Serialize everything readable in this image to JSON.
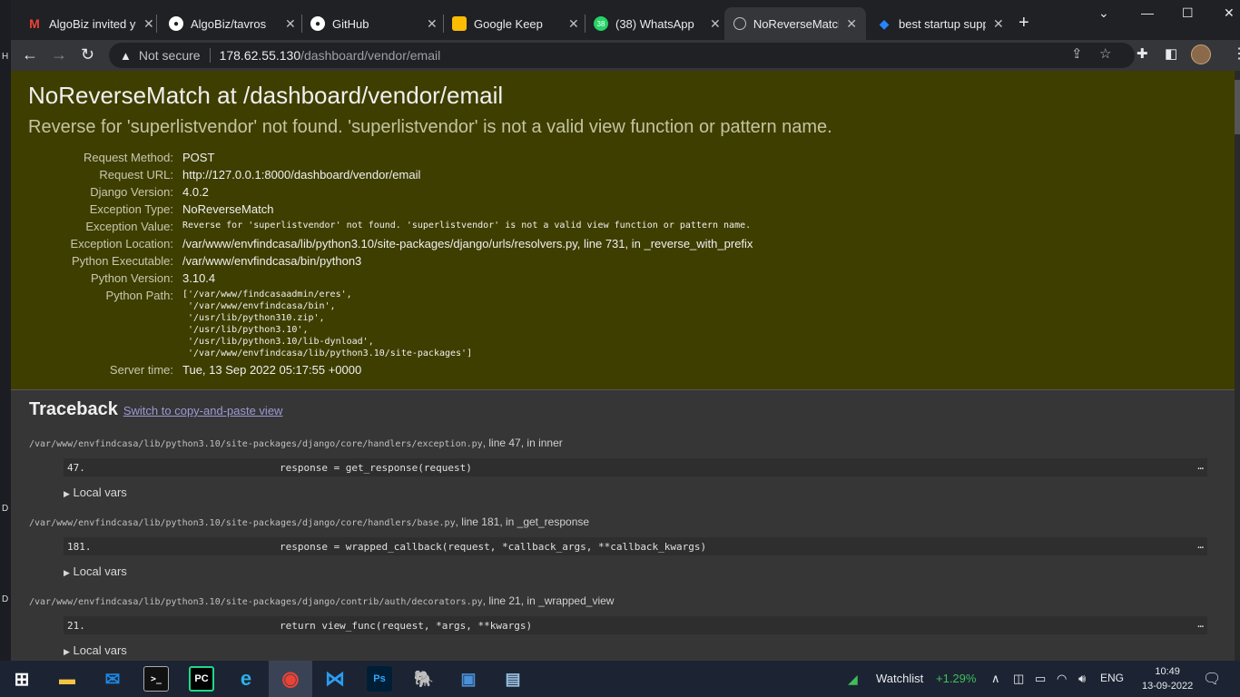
{
  "desktop": {
    "labels": [
      "H",
      "D",
      "D"
    ]
  },
  "browser": {
    "tabs": [
      {
        "title": "AlgoBiz invited you",
        "icon": "gmail-icon",
        "color": "#ea4335"
      },
      {
        "title": "AlgoBiz/tavros",
        "icon": "github-icon",
        "color": "#ffffff"
      },
      {
        "title": "GitHub",
        "icon": "github-icon",
        "color": "#ffffff"
      },
      {
        "title": "Google Keep",
        "icon": "keep-icon",
        "color": "#fbbc04"
      },
      {
        "title": "(38) WhatsApp",
        "icon": "whatsapp-icon",
        "color": "#25d366",
        "badge": "38"
      },
      {
        "title": "NoReverseMatch a",
        "icon": "globe-icon",
        "color": "#bdc1c6",
        "active": true
      },
      {
        "title": "best startup supp",
        "icon": "jira-icon",
        "color": "#2684ff"
      }
    ],
    "close_glyph": "✕",
    "new_tab_glyph": "+",
    "address": {
      "security_label": "Not secure",
      "host": "178.62.55.130",
      "path": "/dashboard/vendor/email"
    }
  },
  "error": {
    "title": "NoReverseMatch at /dashboard/vendor/email",
    "message": "Reverse for 'superlistvendor' not found. 'superlistvendor' is not a valid view function or pattern name.",
    "meta": [
      {
        "label": "Request Method:",
        "value": "POST"
      },
      {
        "label": "Request URL:",
        "value": "http://127.0.0.1:8000/dashboard/vendor/email"
      },
      {
        "label": "Django Version:",
        "value": "4.0.2"
      },
      {
        "label": "Exception Type:",
        "value": "NoReverseMatch"
      },
      {
        "label": "Exception Value:",
        "value": "Reverse for 'superlistvendor' not found. 'superlistvendor' is not a valid view function or pattern name.",
        "mono": true
      },
      {
        "label": "Exception Location:",
        "value": "/var/www/envfindcasa/lib/python3.10/site-packages/django/urls/resolvers.py, line 731, in _reverse_with_prefix"
      },
      {
        "label": "Python Executable:",
        "value": "/var/www/envfindcasa/bin/python3"
      },
      {
        "label": "Python Version:",
        "value": "3.10.4"
      },
      {
        "label": "Python Path:",
        "value": "['/var/www/findcasaadmin/eres',\n '/var/www/envfindcasa/bin',\n '/usr/lib/python310.zip',\n '/usr/lib/python3.10',\n '/usr/lib/python3.10/lib-dynload',\n '/var/www/envfindcasa/lib/python3.10/site-packages']",
        "mono": true
      },
      {
        "label": "Server time:",
        "value": "Tue, 13 Sep 2022 05:17:55 +0000"
      }
    ]
  },
  "traceback": {
    "heading": "Traceback",
    "switch_link": "Switch to copy-and-paste view",
    "local_vars_label": "Local vars",
    "frames": [
      {
        "path": "/var/www/envfindcasa/lib/python3.10/site-packages/django/core/handlers/exception.py",
        "suffix": ", line 47, in inner",
        "lineno": "47.",
        "code": "                response = get_response(request)"
      },
      {
        "path": "/var/www/envfindcasa/lib/python3.10/site-packages/django/core/handlers/base.py",
        "suffix": ", line 181, in _get_response",
        "lineno": "181.",
        "code": "                response = wrapped_callback(request, *callback_args, **callback_kwargs)"
      },
      {
        "path": "/var/www/envfindcasa/lib/python3.10/site-packages/django/contrib/auth/decorators.py",
        "suffix": ", line 21, in _wrapped_view",
        "lineno": "21.",
        "code": "                return view_func(request, *args, **kwargs)"
      }
    ],
    "ellipsis": "…"
  },
  "taskbar": {
    "apps": [
      {
        "name": "start-button",
        "glyph": "⊞",
        "color": "#ffffff"
      },
      {
        "name": "file-explorer-icon",
        "glyph": "▬",
        "color": "#f5c542"
      },
      {
        "name": "mail-icon",
        "glyph": "✉",
        "color": "#1e88e5"
      },
      {
        "name": "terminal-icon",
        "glyph": ">_",
        "color": "#cccccc"
      },
      {
        "name": "pycharm-icon",
        "glyph": "PC",
        "color": "#21d789"
      },
      {
        "name": "edge-icon",
        "glyph": "e",
        "color": "#2bb0e8"
      },
      {
        "name": "chrome-icon",
        "glyph": "◉",
        "color": "#ea4335"
      },
      {
        "name": "vscode-icon",
        "glyph": "⋈",
        "color": "#2b9cf2"
      },
      {
        "name": "photoshop-icon",
        "glyph": "Ps",
        "color": "#31a8ff"
      },
      {
        "name": "postgres-icon",
        "glyph": "🐘",
        "color": "#5b8ac7"
      },
      {
        "name": "network-app-icon",
        "glyph": "▣",
        "color": "#4a90d9"
      },
      {
        "name": "image-viewer-icon",
        "glyph": "▤",
        "color": "#9cc3e6"
      }
    ],
    "watchlist_label": "Watchlist",
    "watchlist_change": "+1.29%",
    "language": "ENG",
    "time": "10:49",
    "date": "13-09-2022"
  }
}
